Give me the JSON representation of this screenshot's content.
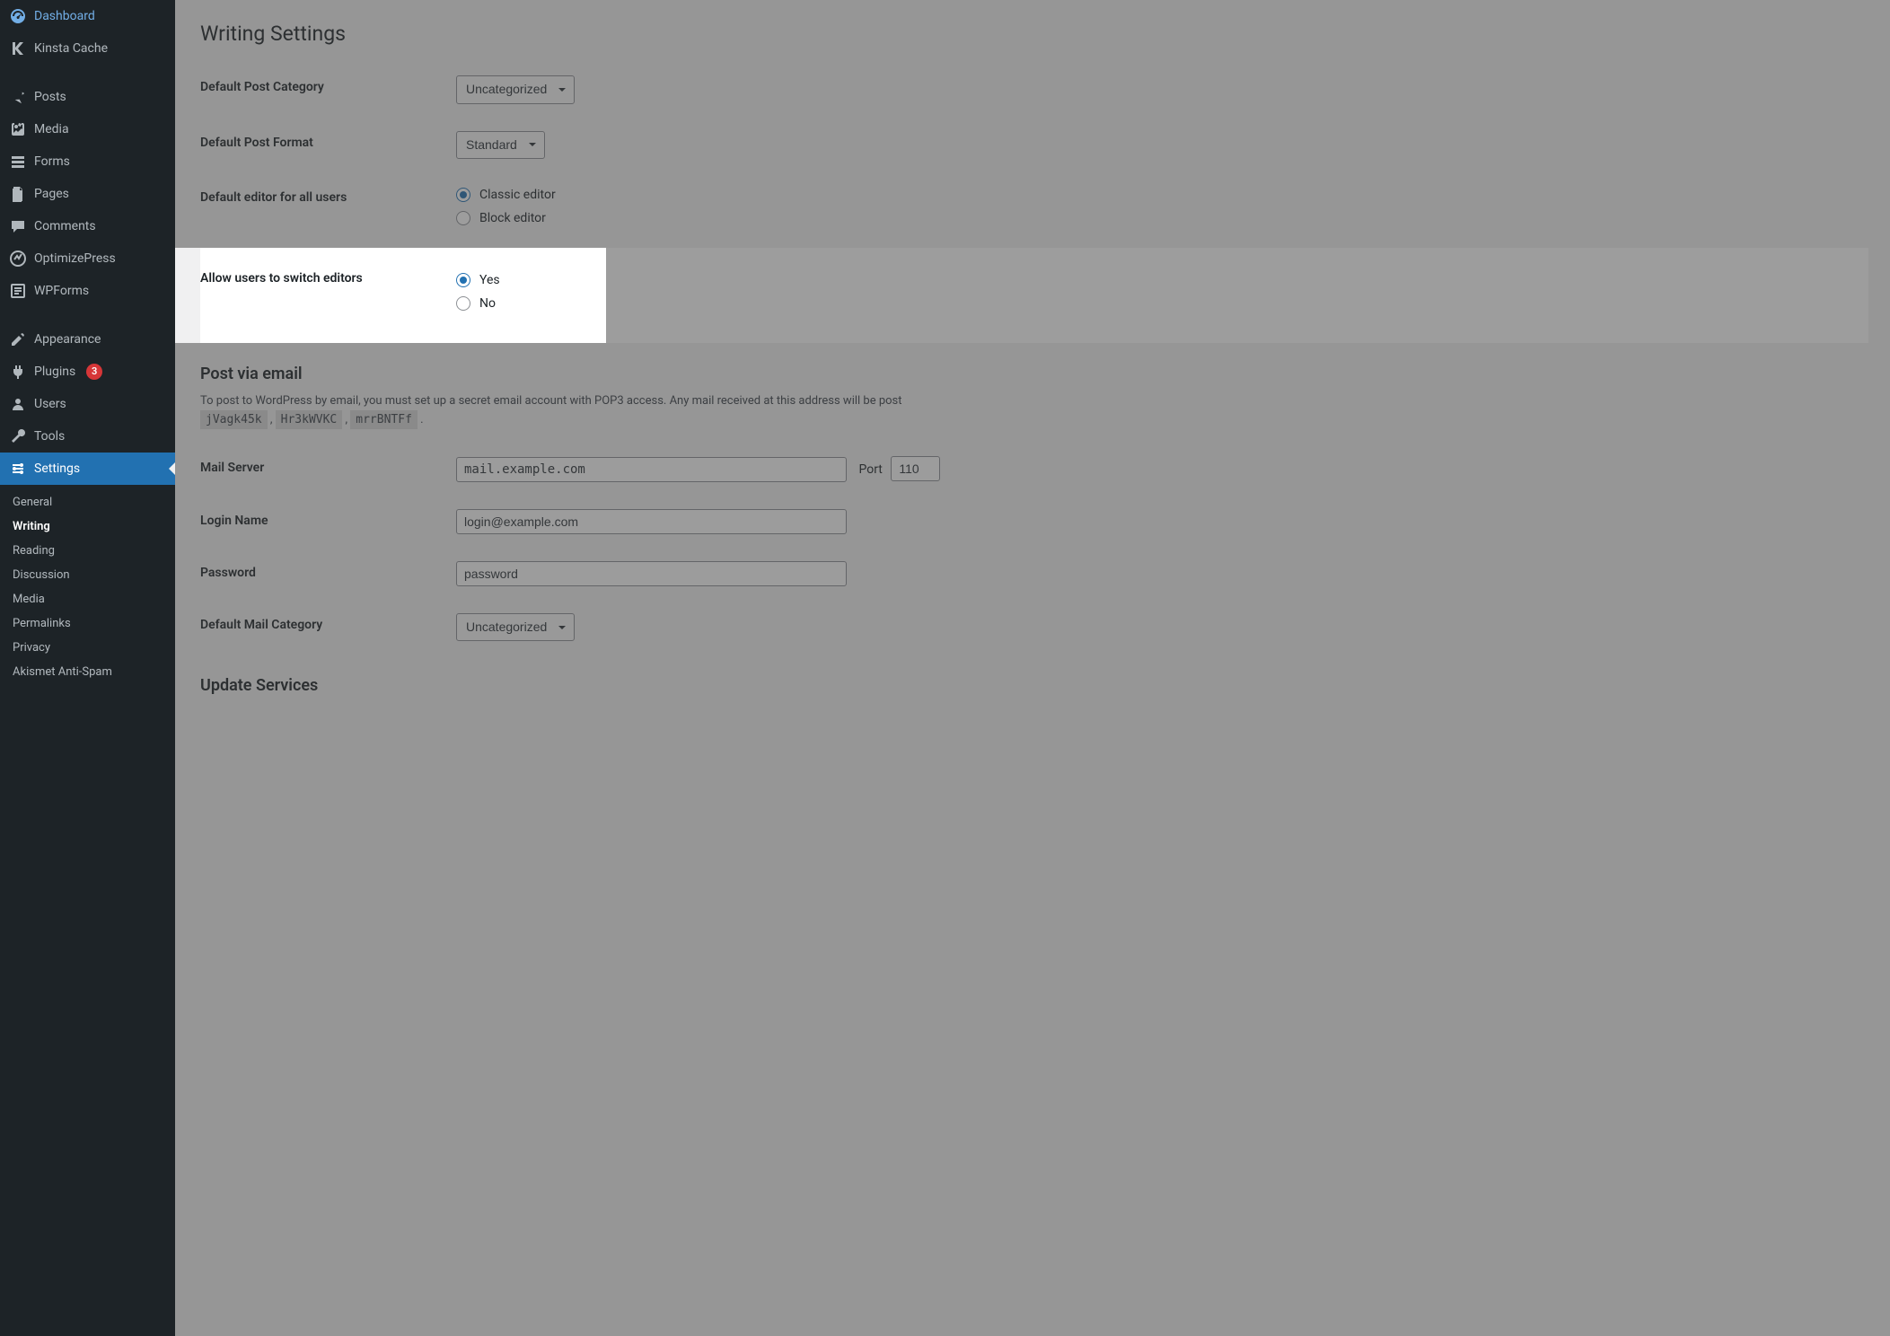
{
  "sidebar": {
    "items": [
      {
        "label": "Dashboard",
        "icon": "dashboard"
      },
      {
        "label": "Kinsta Cache",
        "icon": "kinsta"
      },
      {
        "label": "Posts",
        "icon": "pin"
      },
      {
        "label": "Media",
        "icon": "media"
      },
      {
        "label": "Forms",
        "icon": "forms"
      },
      {
        "label": "Pages",
        "icon": "pages"
      },
      {
        "label": "Comments",
        "icon": "comments"
      },
      {
        "label": "OptimizePress",
        "icon": "optimize"
      },
      {
        "label": "WPForms",
        "icon": "wpforms"
      },
      {
        "label": "Appearance",
        "icon": "appearance"
      },
      {
        "label": "Plugins",
        "icon": "plugins",
        "badge": "3"
      },
      {
        "label": "Users",
        "icon": "users"
      },
      {
        "label": "Tools",
        "icon": "tools"
      },
      {
        "label": "Settings",
        "icon": "settings",
        "current": true
      }
    ],
    "submenu": [
      {
        "label": "General"
      },
      {
        "label": "Writing",
        "active": true
      },
      {
        "label": "Reading"
      },
      {
        "label": "Discussion"
      },
      {
        "label": "Media"
      },
      {
        "label": "Permalinks"
      },
      {
        "label": "Privacy"
      },
      {
        "label": "Akismet Anti-Spam"
      }
    ]
  },
  "page": {
    "title": "Writing Settings",
    "fields": {
      "default_post_category_label": "Default Post Category",
      "default_post_category_value": "Uncategorized",
      "default_post_format_label": "Default Post Format",
      "default_post_format_value": "Standard",
      "default_editor_label": "Default editor for all users",
      "default_editor_options": [
        "Classic editor",
        "Block editor"
      ],
      "default_editor_selected": "Classic editor",
      "allow_switch_label": "Allow users to switch editors",
      "allow_switch_options": [
        "Yes",
        "No"
      ],
      "allow_switch_selected": "Yes",
      "post_via_email_heading": "Post via email",
      "post_via_email_desc": "To post to WordPress by email, you must set up a secret email account with POP3 access. Any mail received at this address will be post",
      "post_via_email_codes": [
        "jVagk45k",
        "Hr3kWVKC",
        "mrrBNTFf"
      ],
      "mail_server_label": "Mail Server",
      "mail_server_value": "mail.example.com",
      "port_label": "Port",
      "port_value": "110",
      "login_name_label": "Login Name",
      "login_name_value": "login@example.com",
      "password_label": "Password",
      "password_value": "password",
      "default_mail_category_label": "Default Mail Category",
      "default_mail_category_value": "Uncategorized",
      "update_services_heading": "Update Services"
    }
  }
}
